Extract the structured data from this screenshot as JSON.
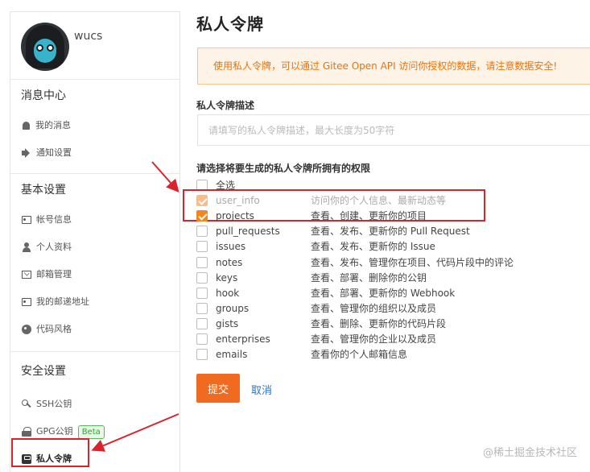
{
  "profile": {
    "username": "wucs"
  },
  "sidebar": {
    "groups": [
      {
        "title": "消息中心",
        "items": [
          {
            "label": "我的消息",
            "icon": "bell-icon"
          },
          {
            "label": "通知设置",
            "icon": "volume-icon"
          }
        ]
      },
      {
        "title": "基本设置",
        "items": [
          {
            "label": "帐号信息",
            "icon": "id-card-icon"
          },
          {
            "label": "个人资料",
            "icon": "user-icon"
          },
          {
            "label": "邮箱管理",
            "icon": "mail-icon"
          },
          {
            "label": "我的邮递地址",
            "icon": "address-card-icon"
          },
          {
            "label": "代码风格",
            "icon": "palette-icon"
          }
        ]
      },
      {
        "title": "安全设置",
        "items": [
          {
            "label": "SSH公钥",
            "icon": "key-icon"
          },
          {
            "label": "GPG公钥",
            "icon": "lock-icon",
            "badge": "Beta"
          },
          {
            "label": "私人令牌",
            "icon": "token-icon",
            "active": true
          }
        ]
      }
    ]
  },
  "main": {
    "title": "私人令牌",
    "notice": "使用私人令牌，可以通过 Gitee Open API 访问你授权的数据，请注意数据安全!",
    "desc_label": "私人令牌描述",
    "desc_placeholder": "请填写的私人令牌描述，最大长度为50字符",
    "desc_value": "",
    "perm_label": "请选择将要生成的私人令牌所拥有的权限",
    "select_all": "全选",
    "permissions": [
      {
        "name": "user_info",
        "desc": "访问你的个人信息、最新动态等",
        "checked": true,
        "disabled": true
      },
      {
        "name": "projects",
        "desc": "查看、创建、更新你的项目",
        "checked": true
      },
      {
        "name": "pull_requests",
        "desc": "查看、发布、更新你的 Pull Request",
        "checked": false
      },
      {
        "name": "issues",
        "desc": "查看、发布、更新你的 Issue",
        "checked": false
      },
      {
        "name": "notes",
        "desc": "查看、发布、管理你在项目、代码片段中的评论",
        "checked": false
      },
      {
        "name": "keys",
        "desc": "查看、部署、删除你的公钥",
        "checked": false
      },
      {
        "name": "hook",
        "desc": "查看、部署、更新你的 Webhook",
        "checked": false
      },
      {
        "name": "groups",
        "desc": "查看、管理你的组织以及成员",
        "checked": false
      },
      {
        "name": "gists",
        "desc": "查看、删除、更新你的代码片段",
        "checked": false
      },
      {
        "name": "enterprises",
        "desc": "查看、管理你的企业以及成员",
        "checked": false
      },
      {
        "name": "emails",
        "desc": "查看你的个人邮箱信息",
        "checked": false
      }
    ],
    "submit_label": "提交",
    "cancel_label": "取消"
  },
  "watermark": "@稀土掘金技术社区",
  "colors": {
    "accent": "#f06a1f",
    "annotation": "#d9232d",
    "link": "#2a74c7"
  }
}
